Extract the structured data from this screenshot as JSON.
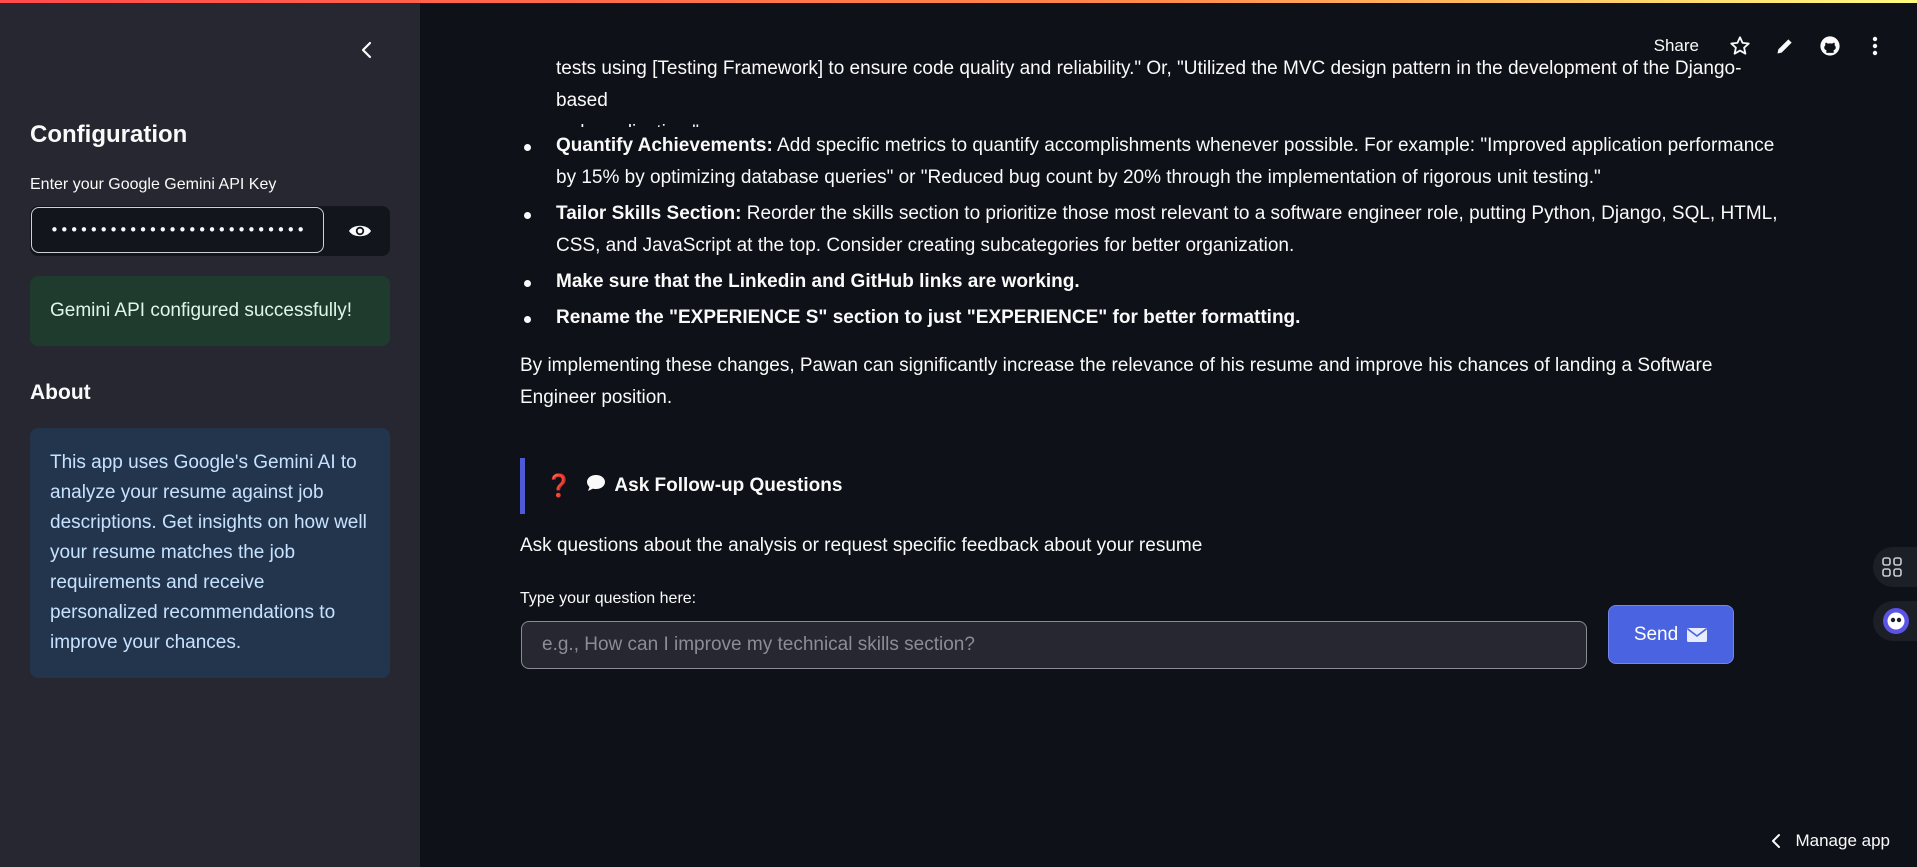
{
  "sidebar": {
    "config_title": "Configuration",
    "api_label": "Enter your Google Gemini API Key",
    "api_value": "••••••••••••••••••••••••••••••••••••••",
    "success_message": "Gemini API configured successfully!",
    "about_title": "About",
    "about_text": "This app uses Google's Gemini AI to analyze your resume against job descriptions. Get insights on how well your resume matches the job requirements and receive personalized recommendations to improve your chances."
  },
  "header": {
    "share_label": "Share"
  },
  "main": {
    "clipped_line_1": "tests using [Testing Framework] to ensure code quality and reliability.\" Or, \"Utilized the MVC design pattern in the development of the Django-based",
    "clipped_line_2": "web application.\"",
    "recommendations": [
      {
        "bold": "Quantify Achievements:",
        "text": " Add specific metrics to quantify accomplishments whenever possible. For example: \"Improved application performance by 15% by optimizing database queries\" or \"Reduced bug count by 20% through the implementation of rigorous unit testing.\""
      },
      {
        "bold": "Tailor Skills Section:",
        "text": " Reorder the skills section to prioritize those most relevant to a software engineer role, putting Python, Django, SQL, HTML, CSS, and JavaScript at the top. Consider creating subcategories for better organization."
      },
      {
        "bold": "Make sure that the Linkedin and GitHub links are working.",
        "text": ""
      },
      {
        "bold": "Rename the \"EXPERIENCE S\" section to just \"EXPERIENCE\" for better formatting.",
        "text": ""
      }
    ],
    "conclusion": "By implementing these changes, Pawan can significantly increase the relevance of his resume and improve his chances of landing a Software Engineer position.",
    "ask_title": "Ask Follow-up Questions",
    "ask_description": "Ask questions about the analysis or request specific feedback about your resume",
    "question_label": "Type your question here:",
    "question_placeholder": "e.g., How can I improve my technical skills section?",
    "send_label": "Send"
  },
  "footer": {
    "manage_label": "Manage app"
  },
  "colors": {
    "accent": "#4a63e0",
    "success_bg": "#1f3b2d",
    "info_bg": "#22354d",
    "sidebar_bg": "#262730",
    "main_bg": "#0e1117"
  }
}
